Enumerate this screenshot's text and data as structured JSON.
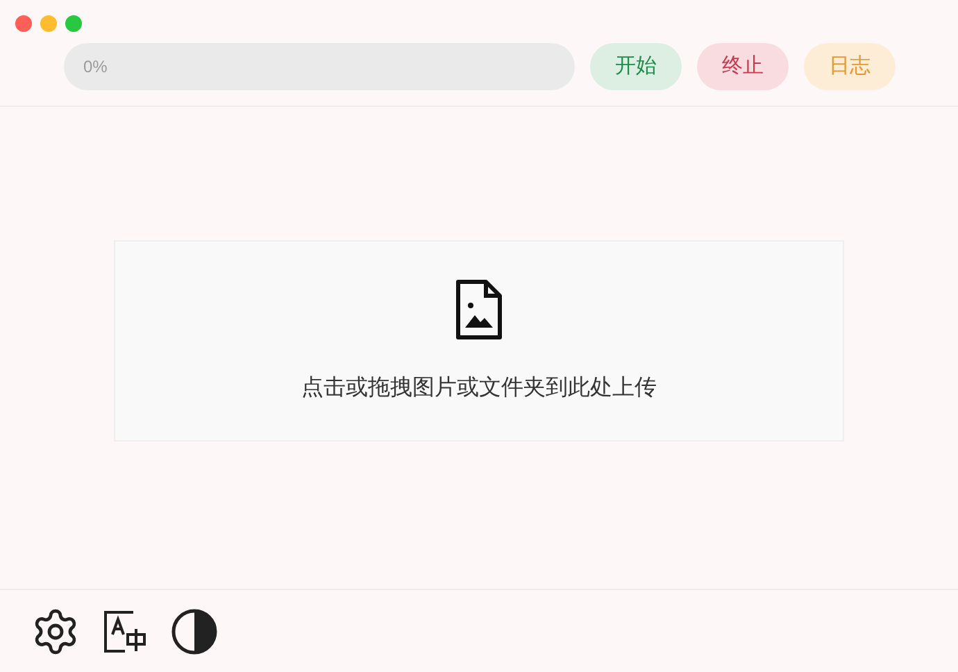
{
  "window": {
    "controls": [
      {
        "kind": "close"
      },
      {
        "kind": "minimize"
      },
      {
        "kind": "maximize"
      }
    ]
  },
  "progress": {
    "level": 0,
    "reading": "0%"
  },
  "buttons": [
    {
      "label": "开始",
      "kind": "start"
    },
    {
      "label": "终止",
      "kind": "stop"
    },
    {
      "label": "日志",
      "kind": "log"
    }
  ],
  "dropzone": {
    "hint": "点击或拖拽图片或文件夹到此处上传"
  },
  "footer": {
    "tools": [
      {
        "kind": "settings"
      },
      {
        "kind": "language"
      },
      {
        "kind": "theme"
      }
    ]
  }
}
